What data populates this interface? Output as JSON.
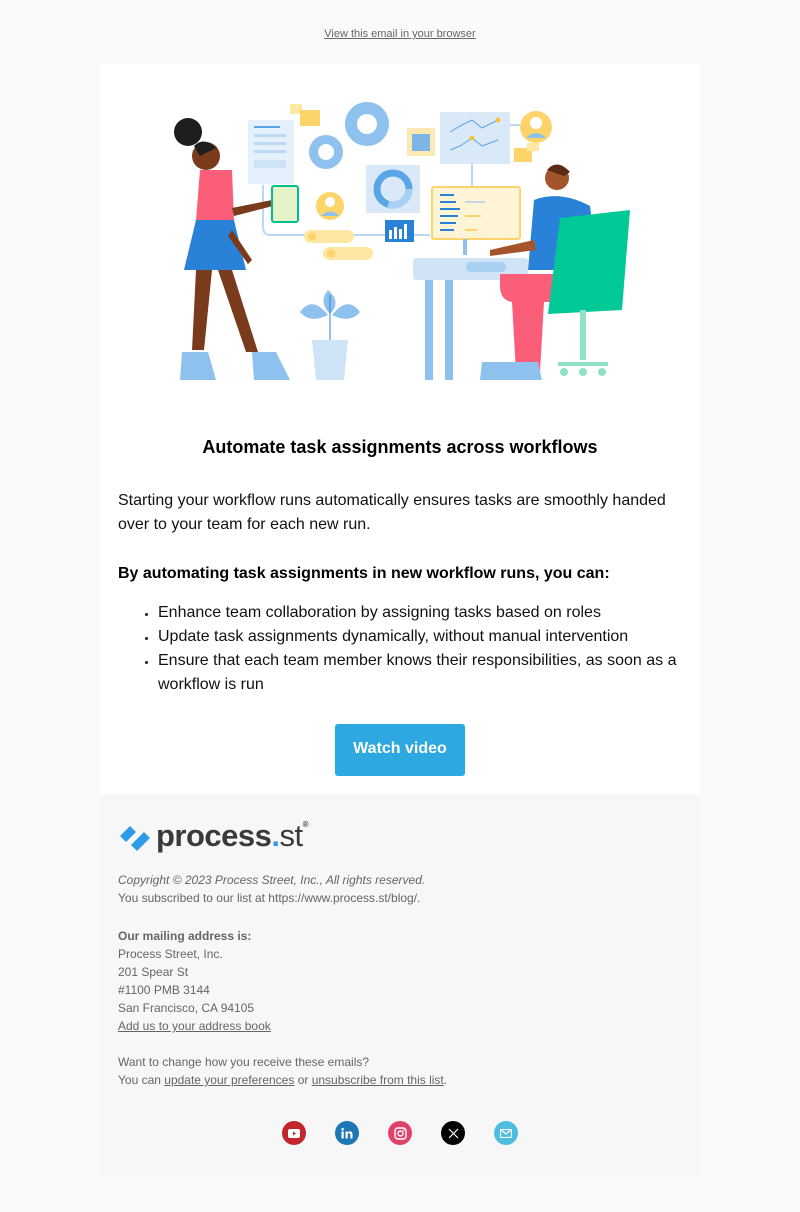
{
  "preheader": {
    "view_in_browser": "View this email in your browser"
  },
  "hero": {
    "illustration": "team-workflow-illustration"
  },
  "content": {
    "title": "Automate task assignments across workflows",
    "intro": "Starting your workflow runs automatically ensures tasks are smoothly handed over to your team for each new run.",
    "subhead": "By automating task assignments in new workflow runs, you can:",
    "bullets": [
      "Enhance team collaboration by assigning tasks based on roles",
      "Update task assignments dynamically, without manual intervention",
      "Ensure that each team member knows their responsibilities, as soon as a workflow is run"
    ],
    "cta_label": "Watch video"
  },
  "footer": {
    "logo": {
      "word": "process",
      "dot": ".",
      "suffix": "st",
      "reg": "®"
    },
    "copyright": "Copyright © 2023 Process Street, Inc., All rights reserved.",
    "subscribed": "You subscribed to our list at https://www.process.st/blog/.",
    "mailing_heading": "Our mailing address is:",
    "address": [
      "Process Street, Inc.",
      "201 Spear St",
      "#1100 PMB 3144",
      "San Francisco, CA 94105"
    ],
    "address_book_link": "Add us to your address book",
    "change_text": "Want to change how you receive these emails?",
    "you_can": "You can ",
    "update_link": "update your preferences",
    "or": " or ",
    "unsubscribe_link": "unsubscribe from this list",
    "period": ".",
    "social": [
      {
        "name": "youtube",
        "color": "#c4242b"
      },
      {
        "name": "linkedin",
        "color": "#1d77b4"
      },
      {
        "name": "instagram",
        "color": "#e0436a"
      },
      {
        "name": "x",
        "color": "#000000"
      },
      {
        "name": "email",
        "color": "#4fbde0"
      }
    ]
  },
  "colors": {
    "accent": "#2ea8e0",
    "background": "#fafafa",
    "card": "#ffffff"
  }
}
